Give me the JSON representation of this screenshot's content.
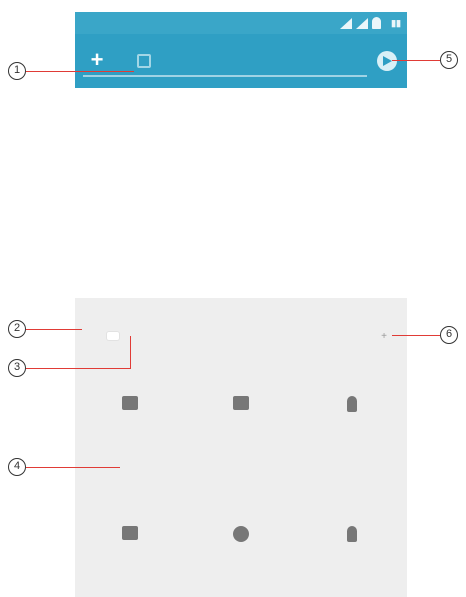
{
  "status_bar": {
    "battery_icon": "battery-icon"
  },
  "action_bar": {
    "plus_icon": "+",
    "gallery_icon": "gallery-icon",
    "send_icon": "send-icon"
  },
  "tabs": {
    "left_icon": "",
    "items": [
      "",
      ""
    ],
    "right_label": ""
  },
  "grid_items": [
    {
      "icon": "mail-icon",
      "label": "",
      "sub": ""
    },
    {
      "icon": "image-icon",
      "label": "",
      "sub": ""
    },
    {
      "icon": "person-icon",
      "label": "",
      "sub": ""
    },
    {
      "icon": "video-icon",
      "label": "",
      "sub": ""
    },
    {
      "icon": "record-icon",
      "label": "",
      "sub": ""
    },
    {
      "icon": "mic-icon",
      "label": "",
      "sub": ""
    }
  ],
  "callouts": [
    "1",
    "2",
    "3",
    "4",
    "5",
    "6"
  ],
  "colors": {
    "action_bar": "#2f9fc4",
    "status_bar": "#3aa6c8",
    "panel": "#eeeeee",
    "leader": "#e03b36"
  }
}
